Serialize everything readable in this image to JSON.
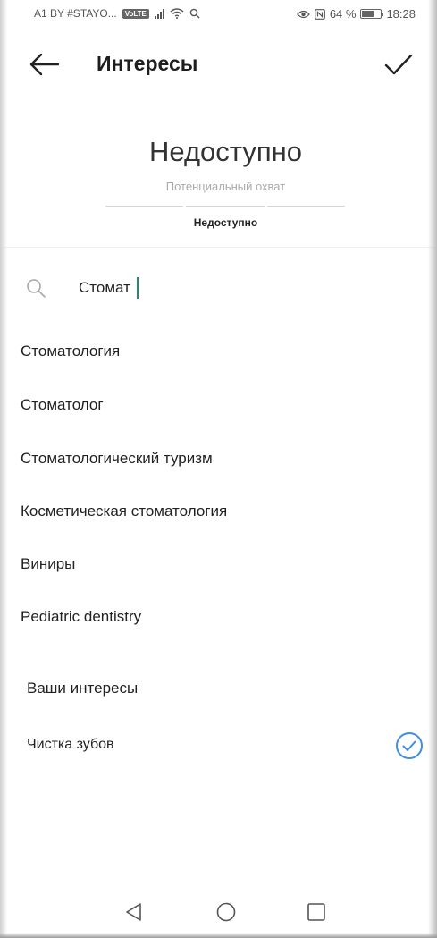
{
  "status_bar": {
    "carrier": "A1 BY #STAYO...",
    "volte": "VoLTE",
    "battery": "64 %",
    "battery_level": 0.64,
    "time": "18:28"
  },
  "header": {
    "title": "Интересы"
  },
  "reach": {
    "value": "Недоступно",
    "label": "Потенциальный охват",
    "status": "Недоступно"
  },
  "search": {
    "value": "Стомат"
  },
  "results": [
    "Стоматология",
    "Стоматолог",
    "Стоматологический туризм",
    "Косметическая стоматология",
    "Виниры",
    "Pediatric dentistry"
  ],
  "your_interests": {
    "heading": "Ваши интересы",
    "items": [
      {
        "label": "Чистка зубов",
        "selected": true
      }
    ]
  },
  "colors": {
    "accent": "#1a8f73",
    "check_blue": "#3d8fe0"
  },
  "icons": [
    "arrow-left-icon",
    "check-icon",
    "search-icon",
    "check-circle-icon",
    "nav-back-icon",
    "nav-home-icon",
    "nav-recents-icon"
  ]
}
